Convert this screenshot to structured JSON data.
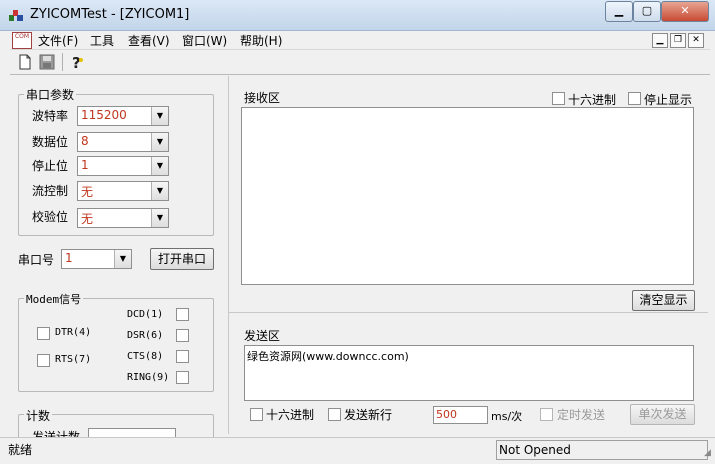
{
  "window": {
    "title": "ZYICOMTest - [ZYICOM1]",
    "min_label": "▁",
    "max_label": "▢",
    "close_label": "✕"
  },
  "menu": {
    "items": [
      "文件(F)",
      "工具",
      "查看(V)",
      "窗口(W)",
      "帮助(H)"
    ],
    "doc_icon_text": "COM"
  },
  "serial": {
    "group_title": "串口参数",
    "fields": [
      {
        "label": "波特率",
        "value": "115200"
      },
      {
        "label": "数据位",
        "value": "8"
      },
      {
        "label": "停止位",
        "value": "1"
      },
      {
        "label": "流控制",
        "value": "无"
      },
      {
        "label": "校验位",
        "value": "无"
      }
    ],
    "port_label": "串口号",
    "port_value": "1",
    "open_button": "打开串口"
  },
  "modem": {
    "group_title": "Modem信号",
    "dtr": "DTR(4)",
    "rts": "RTS(7)",
    "dcd": "DCD(1)",
    "dsr": "DSR(6)",
    "cts": "CTS(8)",
    "ring": "RING(9)"
  },
  "count": {
    "group_title": "计数",
    "partial_label": "发送计数"
  },
  "receive": {
    "title": "接收区",
    "hex_label": "十六进制",
    "stop_label": "停止显示",
    "clear_button": "清空显示"
  },
  "send": {
    "title": "发送区",
    "text": "绿色资源网(www.downcc.com)",
    "hex_label": "十六进制",
    "newline_label": "发送新行",
    "interval_value": "500",
    "interval_unit": "ms/次",
    "timed_label": "定时发送",
    "single_button": "单次发送"
  },
  "status": {
    "left": "就绪",
    "right": "Not Opened"
  }
}
